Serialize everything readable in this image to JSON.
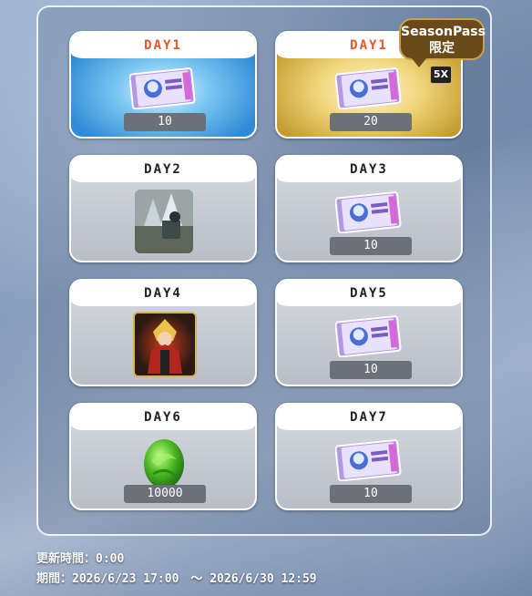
{
  "badge": {
    "line1": "SeasonPass",
    "line2": "限定"
  },
  "cards": [
    {
      "day": "DAY1",
      "qty": "10"
    },
    {
      "day": "DAY1",
      "qty": "20"
    },
    {
      "day": "DAY2",
      "qty": ""
    },
    {
      "day": "DAY3",
      "qty": "10"
    },
    {
      "day": "DAY4",
      "qty": ""
    },
    {
      "day": "DAY5",
      "qty": "10"
    },
    {
      "day": "DAY6",
      "qty": "10000"
    },
    {
      "day": "DAY7",
      "qty": "10"
    }
  ],
  "sx_label": "5X",
  "ticket_text": "REALITY TICKET",
  "info": {
    "update": "更新時間：0:00",
    "period": "期間：2026/6/23 17:00　～ 2026/6/30 12:59"
  },
  "colors": {
    "accent_day": "#e4572a",
    "qty_bg": "#6c7079",
    "badge_bg": "#6a4a1a"
  }
}
